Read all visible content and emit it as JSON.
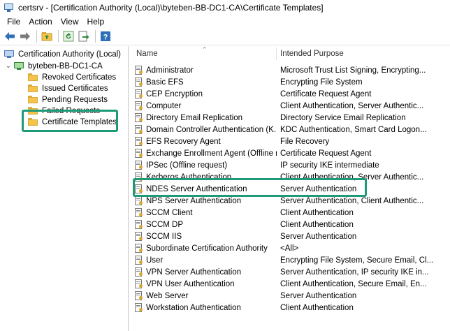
{
  "window": {
    "title": "certsrv - [Certification Authority (Local)\\byteben-BB-DC1-CA\\Certificate Templates]"
  },
  "menu": {
    "items": [
      "File",
      "Action",
      "View",
      "Help"
    ]
  },
  "toolbar": {
    "buttons": [
      "back-arrow-icon",
      "forward-arrow-icon",
      "up-folder-icon",
      "refresh-icon",
      "export-list-icon",
      "help-icon"
    ]
  },
  "colors": {
    "highlight": "#1f9a78",
    "folder": "#f4c34c"
  },
  "tree": {
    "root": "Certification Authority (Local)",
    "ca": "byteben-BB-DC1-CA",
    "folders": [
      "Revoked Certificates",
      "Issued Certificates",
      "Pending Requests",
      "Failed Requests",
      "Certificate Templates"
    ]
  },
  "list": {
    "columns": {
      "name": "Name",
      "purpose": "Intended Purpose"
    },
    "rows": [
      {
        "name": "Administrator",
        "purpose": "Microsoft Trust List Signing, Encrypting..."
      },
      {
        "name": "Basic EFS",
        "purpose": "Encrypting File System"
      },
      {
        "name": "CEP Encryption",
        "purpose": "Certificate Request Agent"
      },
      {
        "name": "Computer",
        "purpose": "Client Authentication, Server Authentic..."
      },
      {
        "name": "Directory Email Replication",
        "purpose": "Directory Service Email Replication"
      },
      {
        "name": "Domain Controller Authentication (K...",
        "purpose": "KDC Authentication, Smart Card Logon..."
      },
      {
        "name": "EFS Recovery Agent",
        "purpose": "File Recovery"
      },
      {
        "name": "Exchange Enrollment Agent (Offline r...",
        "purpose": "Certificate Request Agent"
      },
      {
        "name": "IPSec (Offline request)",
        "purpose": "IP security IKE intermediate"
      },
      {
        "name": "Kerberos Authentication",
        "purpose": "Client Authentication, Server Authentic..."
      },
      {
        "name": "NDES Server Authentication",
        "purpose": "Server Authentication"
      },
      {
        "name": "NPS Server Authentication",
        "purpose": "Server Authentication, Client Authentic..."
      },
      {
        "name": "SCCM Client",
        "purpose": "Client Authentication"
      },
      {
        "name": "SCCM DP",
        "purpose": "Client Authentication"
      },
      {
        "name": "SCCM IIS",
        "purpose": "Server Authentication"
      },
      {
        "name": "Subordinate Certification Authority",
        "purpose": "<All>"
      },
      {
        "name": "User",
        "purpose": "Encrypting File System, Secure Email, Cl..."
      },
      {
        "name": "VPN Server Authentication",
        "purpose": "Server Authentication, IP security IKE in..."
      },
      {
        "name": "VPN User Authentication",
        "purpose": "Client Authentication, Secure Email, En..."
      },
      {
        "name": "Web Server",
        "purpose": "Server Authentication"
      },
      {
        "name": "Workstation Authentication",
        "purpose": "Client Authentication"
      }
    ]
  }
}
